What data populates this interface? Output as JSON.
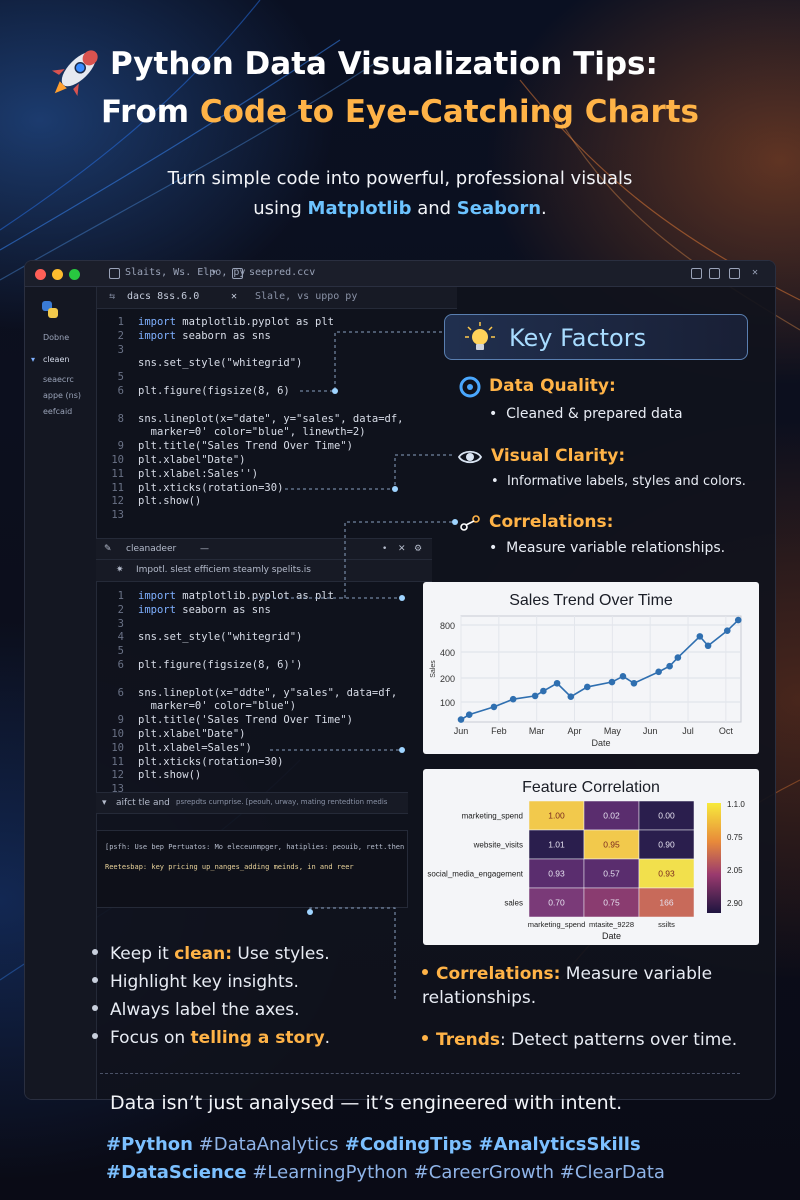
{
  "header": {
    "title_line1": "Python Data Visualization Tips:",
    "title_line2_pre": "From ",
    "title_line2_hl": "Code to Eye-Catching Charts",
    "subtitle_line1": "Turn simple code into powerful, professional visuals",
    "subtitle_pre": "using ",
    "lib1": "Matplotlib",
    "subtitle_mid": " and ",
    "lib2": "Seaborn",
    "subtitle_end": "."
  },
  "window": {
    "tab1": "Slaits, Ws. Elpo, py",
    "tab2": "seepred.ccv",
    "editor_tab1": "dacs 8ss.6.0",
    "editor_tab2": "Slale, vs uppo py",
    "sidebar": [
      "Dobne",
      "cleaen",
      "seaecrc",
      "appe (ns)",
      "eefcaid"
    ],
    "panel1_label": "cleanadeer",
    "panel1_hint": "Impotl. slest efficiem steamly spelits.is",
    "terminal_label": "aifct tle and",
    "terminal_tabs": "psrepdts curnprise.   [peouh, urway, mating rentedtion medis",
    "terminal_line1": "[psfh: Use bep Pertuatos: Mo eleceunmpger, hatiplies: peouib, rett.then",
    "terminal_line2": "Reetesbap: key pricing up_nanges_adding meinds, in and reer"
  },
  "code_top": [
    "import matplotlib.pyplot as plt",
    "import seaborn as sns",
    "",
    "sns.set_style(\"whitegrid\")",
    "",
    "plt.figure(figsize(8, 6)",
    "",
    "sns.lineplot(x=\"date\", y=\"sales\", data=df,",
    "  marker=0' color=\"blue\", linewth=2)",
    "plt.title(\"Sales Trend Over Time\")",
    "plt.xlabel\"Date\")",
    "plt.xlabel:Sales'')",
    "plt.xticks(rotation=30)",
    "plt.show()",
    ""
  ],
  "code_top_numbers": [
    "1",
    "2",
    "3",
    "",
    "5",
    "6",
    "",
    "8",
    "",
    "9",
    "10",
    "11",
    "11",
    "12",
    "13"
  ],
  "code_bottom": [
    "import matplotlib.pyplot as plt",
    "import seaborn as sns",
    "",
    "sns.set_style(\"whitegrid\")",
    "",
    "plt.figure(figsize(8, 6)')",
    "",
    "sns.lineplot(x=\"ddte\", y\"sales\", data=df,",
    "  marker=0' color=\"blue\")",
    "plt.title('Sales Trend Over Time\")",
    "plt.xlabel\"Date\")",
    "plt.xlabel=Sales\")",
    "plt.xticks(rotation=30)",
    "plt.show()",
    ""
  ],
  "code_bottom_numbers": [
    "1",
    "2",
    "3",
    "4",
    "5",
    "6",
    "",
    "6",
    "",
    "9",
    "10",
    "10",
    "11",
    "12",
    "13"
  ],
  "key_factors": {
    "title": "Key Factors",
    "items": [
      {
        "head": "Data Quality:",
        "bullet": "Cleaned & prepared data"
      },
      {
        "head": "Visual Clarity:",
        "bullet": "Informative labels, styles and colors."
      },
      {
        "head": "Correlations:",
        "bullet": "Measure variable relationships."
      }
    ]
  },
  "chart_data": [
    {
      "type": "line",
      "title": "Sales Trend Over Time",
      "xlabel": "Date",
      "ylabel": "Sales",
      "x_ticks": [
        "Jun",
        "Feb",
        "Mar",
        "Apr",
        "May",
        "Jun",
        "Jul",
        "Oct"
      ],
      "y_ticks": [
        100,
        200,
        400,
        800
      ],
      "ylim": [
        0,
        900
      ],
      "points": [
        {
          "x": 0.0,
          "y": 30
        },
        {
          "x": 0.3,
          "y": 90
        },
        {
          "x": 1.2,
          "y": 185
        },
        {
          "x": 1.9,
          "y": 280
        },
        {
          "x": 2.7,
          "y": 320
        },
        {
          "x": 3.0,
          "y": 380
        },
        {
          "x": 3.5,
          "y": 475
        },
        {
          "x": 4.0,
          "y": 310
        },
        {
          "x": 4.6,
          "y": 430
        },
        {
          "x": 5.5,
          "y": 490
        },
        {
          "x": 5.9,
          "y": 560
        },
        {
          "x": 6.3,
          "y": 475
        },
        {
          "x": 7.2,
          "y": 615
        },
        {
          "x": 7.6,
          "y": 685
        },
        {
          "x": 7.9,
          "y": 790
        },
        {
          "x": 8.7,
          "y": 1050
        },
        {
          "x": 9.0,
          "y": 935
        },
        {
          "x": 9.7,
          "y": 1120
        },
        {
          "x": 10.1,
          "y": 1250
        }
      ],
      "grid": true,
      "color": "#2f6fb0"
    },
    {
      "type": "heatmap",
      "title": "Feature Correlation",
      "xlabel": "Date",
      "rows": [
        "marketing_spend",
        "website_visits",
        "social_media_engagement",
        "sales"
      ],
      "cols": [
        "marketing_spend",
        "mtasite_9228",
        "ssilts"
      ],
      "values": [
        [
          "1.00",
          "0.02",
          "0.00"
        ],
        [
          "1.01",
          "0.95",
          "0.90"
        ],
        [
          "0.93",
          "0.57",
          "0.93"
        ],
        [
          "0.70",
          "0.75",
          "166"
        ]
      ],
      "cell_colors": [
        [
          "#f2c94c",
          "#5a2d6e",
          "#2a1e4d"
        ],
        [
          "#2a1e4d",
          "#f2c94c",
          "#2a1e4d"
        ],
        [
          "#5a2d6e",
          "#5a2d6e",
          "#f2e04c"
        ],
        [
          "#7a3a78",
          "#8a3c70",
          "#c86a5a"
        ]
      ],
      "colorbar_ticks": [
        "1.1.0",
        "0.75",
        "2.05",
        "2.90"
      ]
    }
  ],
  "tips_left": [
    {
      "pre": "Keep it ",
      "hl": "clean:",
      "post": " Use styles."
    },
    {
      "pre": "Highlight key insights.",
      "hl": "",
      "post": ""
    },
    {
      "pre": "Always label the axes.",
      "hl": "",
      "post": ""
    },
    {
      "pre": "Focus on ",
      "hl": "telling a story",
      "post": "."
    }
  ],
  "tips_right": [
    {
      "hl": "Correlations:",
      "post": " Measure variable relationships."
    },
    {
      "hl": "Trends",
      "post": ": Detect patterns over time."
    }
  ],
  "quote": "Data isn’t just analysed — it’s engineered with intent.",
  "hashtags_line1": [
    {
      "t": "#Python",
      "b": true
    },
    {
      "t": " #DataAnalytics",
      "b": false
    },
    {
      "t": " #CodingTips",
      "b": true
    },
    {
      "t": " #AnalyticsSkills",
      "b": true
    }
  ],
  "hashtags_line2": [
    {
      "t": "#DataScience",
      "b": true
    },
    {
      "t": " #LearningPython",
      "b": false
    },
    {
      "t": " #CareerGrowth",
      "b": false
    },
    {
      "t": " #ClearData",
      "b": false
    }
  ],
  "colors": {
    "accent": "#ffb347",
    "lib": "#6cc3ff",
    "hashtag": "#7cc0ff"
  }
}
